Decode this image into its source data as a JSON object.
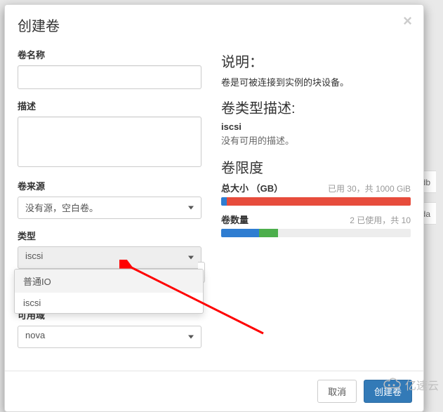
{
  "bg": {
    "row1": "/vdb",
    "row2": "/vda"
  },
  "modal": {
    "title": "创建卷",
    "left": {
      "name_label": "卷名称",
      "name_value": "",
      "desc_label": "描述",
      "desc_value": "",
      "source_label": "卷来源",
      "source_value": "没有源，空白卷。",
      "type_label": "类型",
      "type_value": "iscsi",
      "type_options": [
        "普通IO",
        "iscsi"
      ],
      "az_label": "可用域",
      "az_value": "nova"
    },
    "right": {
      "desc_head": "说明：",
      "desc_text": "卷是可被连接到实例的块设备。",
      "typedesc_head": "卷类型描述:",
      "typedesc_name": "iscsi",
      "typedesc_text": "没有可用的描述。",
      "limits_head": "卷限度",
      "size_label": "总大小 （GB）",
      "size_info": "已用 30，共 1000 GiB",
      "count_label": "卷数量",
      "count_info": "2 已使用，共 10"
    },
    "footer": {
      "cancel": "取消",
      "submit": "创建卷"
    }
  },
  "watermark": "亿速云"
}
